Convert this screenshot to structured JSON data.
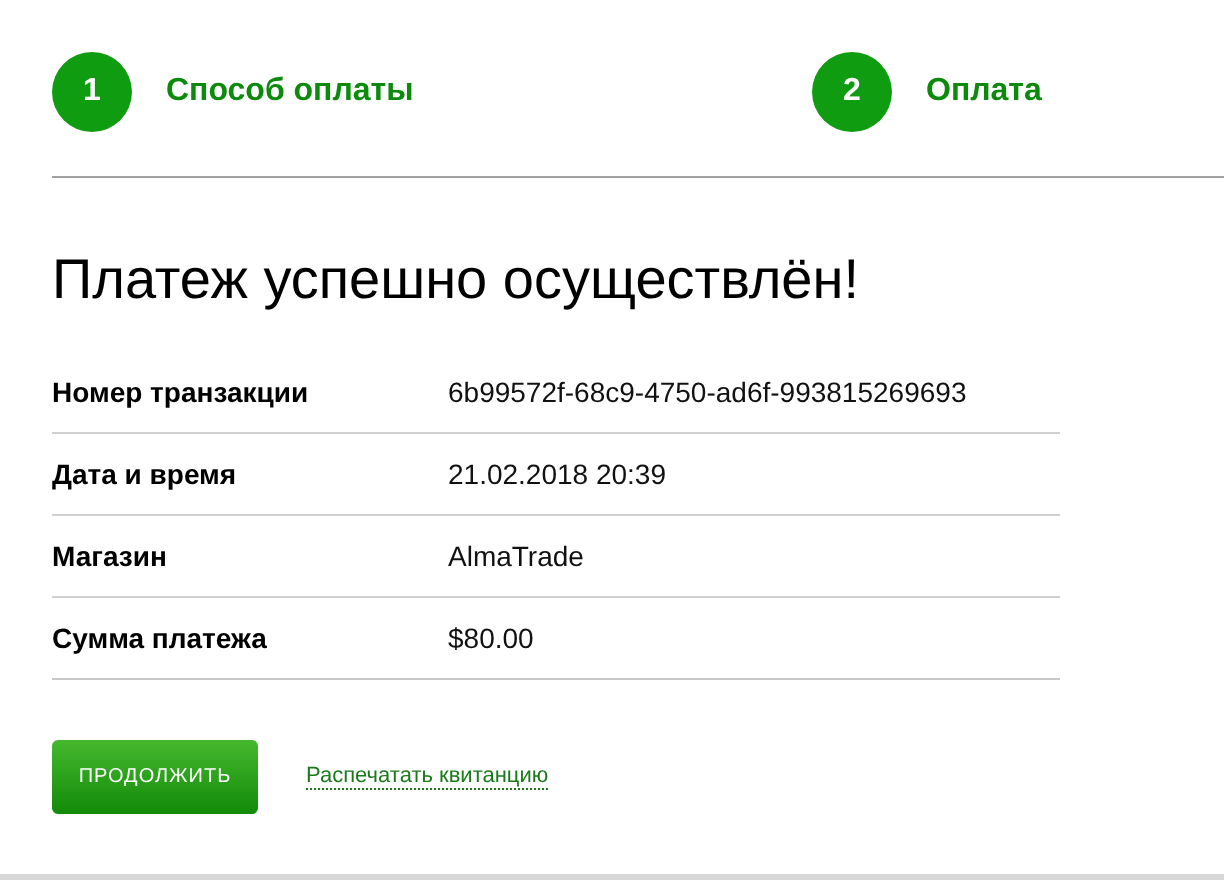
{
  "steps": [
    {
      "number": "1",
      "label": "Способ оплаты"
    },
    {
      "number": "2",
      "label": "Оплата"
    }
  ],
  "title": "Платеж успешно осуществлён!",
  "details": [
    {
      "label": "Номер транзакции",
      "value": "6b99572f-68c9-4750-ad6f-993815269693"
    },
    {
      "label": "Дата и время",
      "value": "21.02.2018 20:39"
    },
    {
      "label": "Магазин",
      "value": "AlmaTrade"
    },
    {
      "label": "Сумма платежа",
      "value": "$80.00"
    }
  ],
  "continue_button": "ПРОДОЛЖИТЬ",
  "print_link": "Распечатать квитанцию"
}
